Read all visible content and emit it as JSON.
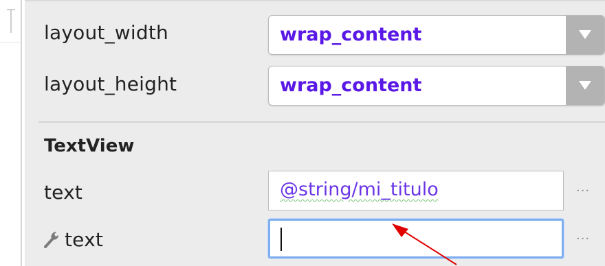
{
  "layout_width": {
    "label": "layout_width",
    "value": "wrap_content"
  },
  "layout_height": {
    "label": "layout_height",
    "value": "wrap_content"
  },
  "textview_section": {
    "title": "TextView",
    "text_attr": {
      "label": "text",
      "value": "@string/mi_titulo",
      "more": "..."
    },
    "tools_text_attr": {
      "label": "text",
      "value": "",
      "more": "...",
      "icon": "wrench-icon"
    }
  },
  "colors": {
    "value_purple": "#5a18e6",
    "focus_blue": "#7faef0",
    "annotation_red": "#e00000"
  }
}
